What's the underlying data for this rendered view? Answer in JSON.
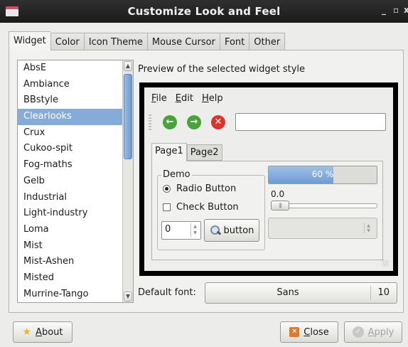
{
  "window": {
    "title": "Customize Look and Feel",
    "controls": [
      "_",
      "▫",
      "x"
    ]
  },
  "tabs": [
    {
      "label": "Widget",
      "active": true
    },
    {
      "label": "Color",
      "active": false
    },
    {
      "label": "Icon Theme",
      "active": false
    },
    {
      "label": "Mouse Cursor",
      "active": false
    },
    {
      "label": "Font",
      "active": false
    },
    {
      "label": "Other",
      "active": false
    }
  ],
  "theme_list": {
    "items": [
      "AbsE",
      "Ambiance",
      "BBstyle",
      "Clearlooks",
      "Crux",
      "Cukoo-spit",
      "Fog-maths",
      "Gelb",
      "Industrial",
      "Light-industry",
      "Loma",
      "Mist",
      "Mist-Ashen",
      "Misted",
      "Murrine-Tango"
    ],
    "selected": "Clearlooks"
  },
  "preview": {
    "label": "Preview of the selected widget style",
    "menu": [
      {
        "label": "File",
        "accel": "F",
        "rest": "ile"
      },
      {
        "label": "Edit",
        "accel": "E",
        "rest": "dit"
      },
      {
        "label": "Help",
        "accel": "H",
        "rest": "elp"
      }
    ],
    "toolbar_icons": [
      {
        "name": "back-icon",
        "glyph": "←",
        "color": "#4aa23a"
      },
      {
        "name": "forward-icon",
        "glyph": "→",
        "color": "#4aa23a"
      },
      {
        "name": "stop-icon",
        "glyph": "✕",
        "color": "#d8352f"
      }
    ],
    "entry_value": "",
    "tabs": [
      {
        "label": "Page1",
        "active": true
      },
      {
        "label": "Page2",
        "active": false
      }
    ],
    "demo_label": "Demo",
    "radio_label": "Radio Button",
    "check_label": "Check Button",
    "spin_value": "0",
    "button_label": "button",
    "progress": {
      "value": 0.6,
      "text": "60 %"
    },
    "scale_value": "0.0"
  },
  "default_font": {
    "label": "Default font:",
    "name": "Sans",
    "size": "10"
  },
  "buttons": {
    "about": {
      "accel": "A",
      "rest": "bout"
    },
    "close": {
      "accel": "C",
      "rest": "lose"
    },
    "apply": {
      "accel": "A",
      "rest": "pply",
      "enabled": false
    }
  },
  "colors": {
    "selection": "#86abd9",
    "progress": "#6f9bd3"
  }
}
